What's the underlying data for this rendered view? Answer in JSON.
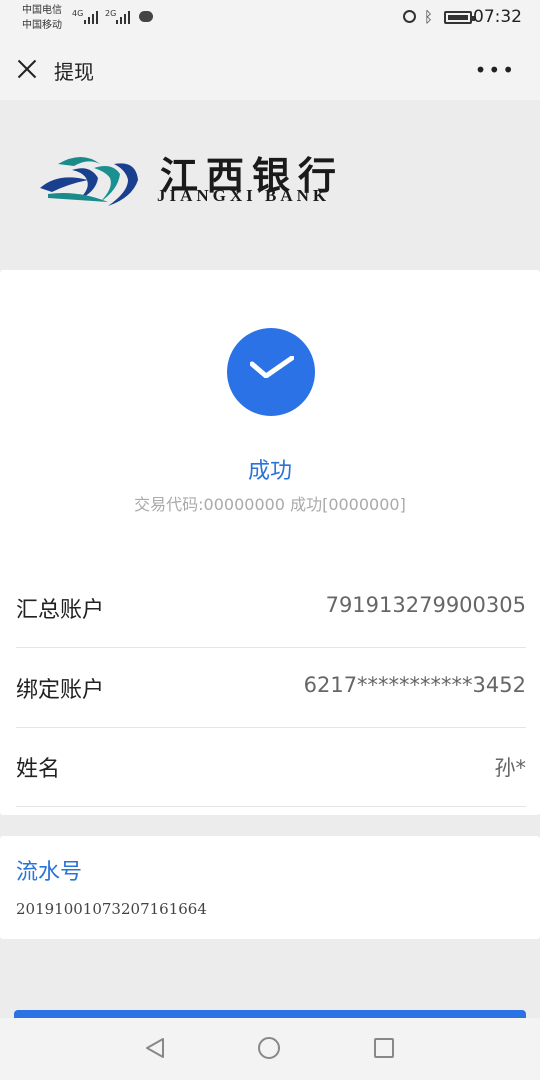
{
  "status_bar": {
    "carrier_1": "中国电信",
    "carrier_2": "中国移动",
    "network_1": "4G",
    "network_2": "2G",
    "time": "07:32"
  },
  "header": {
    "title": "提现",
    "more_label": "•••"
  },
  "banner": {
    "bank_name_cn": "江西银行",
    "bank_name_en": "JIANGXI BANK"
  },
  "result": {
    "status": "成功",
    "transaction_code": "交易代码:00000000 成功[0000000]"
  },
  "details": [
    {
      "label": "汇总账户",
      "value": "791913279900305"
    },
    {
      "label": "绑定账户",
      "value": "6217***********3452"
    },
    {
      "label": "姓名",
      "value": "孙*"
    }
  ],
  "serial": {
    "label": "流水号",
    "value": "20191001073207161664"
  },
  "colors": {
    "accent": "#2a72e6",
    "link": "#2a73d8",
    "background": "#ececec"
  }
}
